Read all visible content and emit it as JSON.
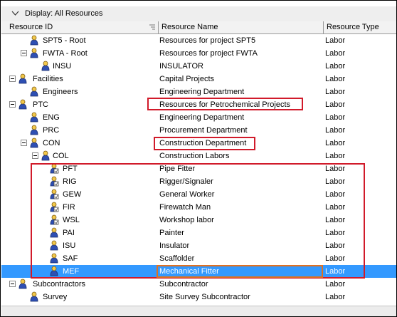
{
  "group_bar": {
    "label": "Display: All Resources"
  },
  "columns": {
    "id": "Resource ID",
    "name": "Resource Name",
    "type": "Resource Type"
  },
  "rows": [
    {
      "id": "SPT5 - Root",
      "name": "Resources for project SPT5",
      "type": "Labor",
      "icon": "person-icon"
    },
    {
      "id": "FWTA - Root",
      "name": "Resources for project FWTA",
      "type": "Labor",
      "icon": "person-icon"
    },
    {
      "id": "INSU",
      "name": "INSULATOR",
      "type": "Labor",
      "icon": "person-icon"
    },
    {
      "id": "Facilities",
      "name": "Capital Projects",
      "type": "Labor",
      "icon": "person-icon"
    },
    {
      "id": "Engineers",
      "name": "Engineering Department",
      "type": "Labor",
      "icon": "person-icon"
    },
    {
      "id": "PTC",
      "name": "Resources for Petrochemical Projects",
      "type": "Labor",
      "icon": "person-icon"
    },
    {
      "id": "ENG",
      "name": "Engineering Department",
      "type": "Labor",
      "icon": "person-icon"
    },
    {
      "id": "PRC",
      "name": "Procurement Department",
      "type": "Labor",
      "icon": "person-icon"
    },
    {
      "id": "CON",
      "name": "Construction Department",
      "type": "Labor",
      "icon": "person-icon"
    },
    {
      "id": "COL",
      "name": "Construction Labors",
      "type": "Labor",
      "icon": "person-icon"
    },
    {
      "id": "PFT",
      "name": "Pipe Fitter",
      "type": "Labor",
      "icon": "person-timesheet-icon"
    },
    {
      "id": "RIG",
      "name": "Rigger/Signaler",
      "type": "Labor",
      "icon": "person-timesheet-icon"
    },
    {
      "id": "GEW",
      "name": "General Worker",
      "type": "Labor",
      "icon": "person-timesheet-icon"
    },
    {
      "id": "FIR",
      "name": "Firewatch Man",
      "type": "Labor",
      "icon": "person-timesheet-icon"
    },
    {
      "id": "WSL",
      "name": "Workshop labor",
      "type": "Labor",
      "icon": "person-timesheet-icon"
    },
    {
      "id": "PAI",
      "name": "Painter",
      "type": "Labor",
      "icon": "person-icon"
    },
    {
      "id": "ISU",
      "name": "Insulator",
      "type": "Labor",
      "icon": "person-icon"
    },
    {
      "id": "SAF",
      "name": "Scaffolder",
      "type": "Labor",
      "icon": "person-icon"
    },
    {
      "id": "MEF",
      "name": "Mechanical Fitter",
      "type": "Labor",
      "icon": "person-icon",
      "selected": true
    },
    {
      "id": "Subcontractors",
      "name": "Subcontractor",
      "type": "Labor",
      "icon": "person-icon"
    },
    {
      "id": "Survey",
      "name": "Site Survey Subcontractor",
      "type": "Labor",
      "icon": "person-icon"
    }
  ],
  "colors": {
    "selection": "#3399ff",
    "annotation_red": "#d11a2a",
    "annotation_orange": "#e07020"
  }
}
